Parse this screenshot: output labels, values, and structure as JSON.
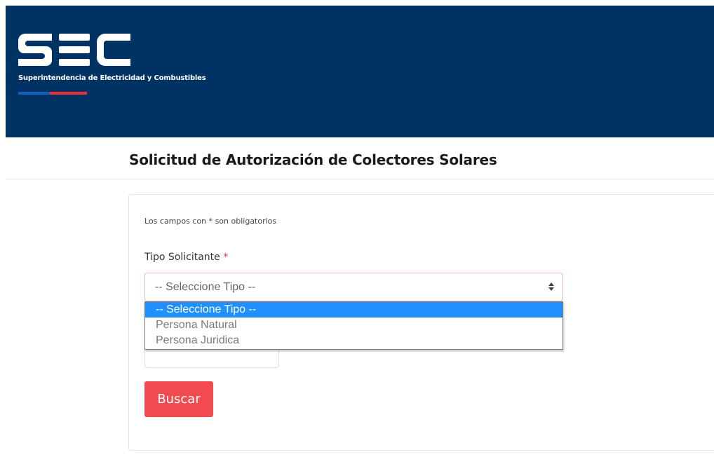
{
  "header": {
    "logo": {
      "mark_text": "SEC",
      "tagline": "Superintendencia de Electricidad y Combustibles"
    },
    "background_color": "#003264"
  },
  "page": {
    "title": "Solicitud de Autorización de Colectores Solares"
  },
  "form": {
    "required_note": "Los campos con * son obligatorios",
    "tipo_solicitante": {
      "label": "Tipo Solicitante",
      "required_mark": "*",
      "selected_value": "-- Seleccione Tipo --",
      "options": [
        "-- Seleccione Tipo --",
        "Persona Natural",
        "Persona Juridica"
      ]
    },
    "search_button_label": "Buscar",
    "colors": {
      "button": "#f24b4f",
      "option_highlight": "#1e90ff",
      "required": "#e5333e"
    }
  }
}
